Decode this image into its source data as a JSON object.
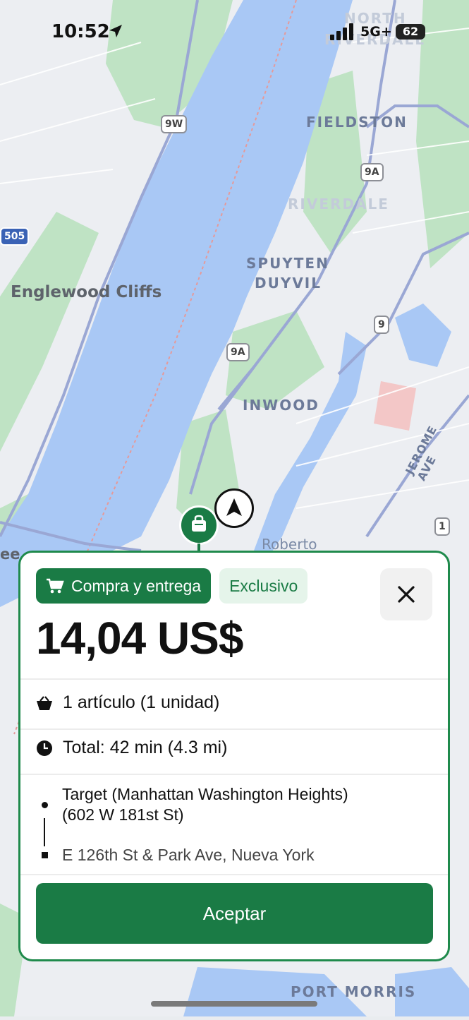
{
  "status_bar": {
    "time": "10:52",
    "network": "5G+",
    "battery": "62"
  },
  "map": {
    "labels": {
      "north_riverdale_1": "NORTH",
      "north_riverdale_2": "RIVERDALE",
      "fieldston": "FIELDSTON",
      "riverdale": "RIVERDALE",
      "spuyten_1": "SPUYTEN",
      "spuyten_2": "DUYVIL",
      "englewood": "Englewood Cliffs",
      "inwood": "INWOOD",
      "jerome": "JEROME AVE",
      "roberto": "Roberto",
      "port_morris": "PORT MORRIS",
      "edge_ee": "ee"
    },
    "shields": {
      "r9w": "9W",
      "r9a_top": "9A",
      "r9a_mid": "9A",
      "r9": "9",
      "r505": "505",
      "r1": "1"
    }
  },
  "offer": {
    "badge_primary": "Compra y entrega",
    "badge_secondary": "Exclusivo",
    "price": "14,04 US$",
    "items": "1 artículo (1 unidad)",
    "total": "Total: 42 min (4.3 mi)",
    "pickup_line1": "Target (Manhattan Washington Heights)",
    "pickup_line2": "(602 W 181st St)",
    "dropoff": "E 126th St & Park Ave, Nueva York",
    "accept_label": "Aceptar"
  },
  "colors": {
    "brand_green": "#1a7b45",
    "river": "#a9c8f5",
    "park": "#bfe3c4"
  }
}
